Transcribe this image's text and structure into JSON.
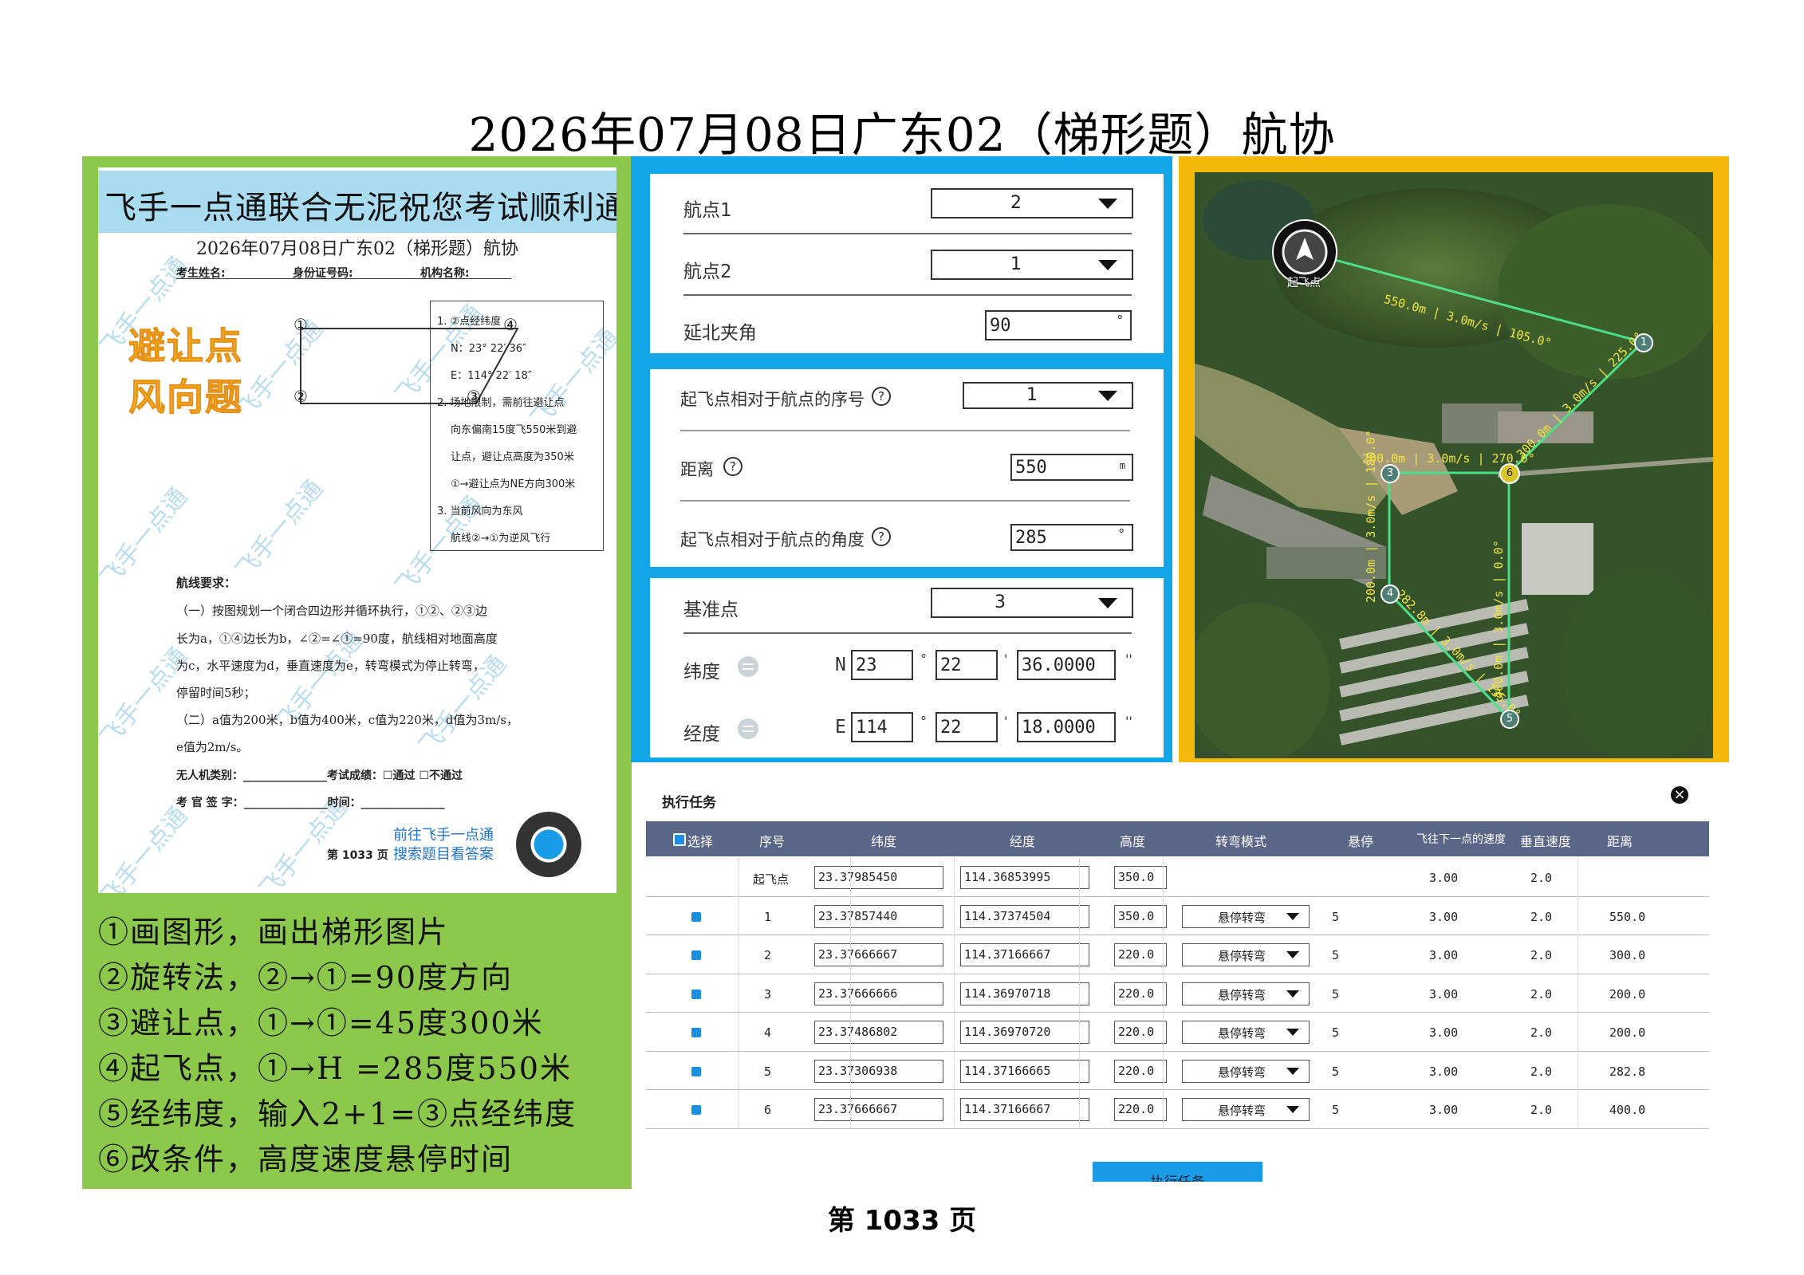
{
  "title": "2026年07月08日广东02（梯形题）航协",
  "page_number": "第 1033 页",
  "paper": {
    "banner": "飞手一点通联合无泥祝您考试顺利通过",
    "title": "2026年07月08日广东02（梯形题）航协",
    "header_fields": [
      "考生姓名:",
      "身份证号码:",
      "机构名称:"
    ],
    "sticker_line1": "避让点",
    "sticker_line2": "风向题",
    "watermark": "飞手一点通",
    "diagram_labels": [
      "①",
      "④",
      "②",
      "③"
    ],
    "box_lines": [
      "1. ②点经纬度",
      "N：23° 22′ 36″",
      "E：114° 22′ 18″",
      "2. 场地限制，需前往避让点",
      "向东偏南15度飞550米到避",
      "让点，避让点高度为350米",
      "①→避让点为NE方向300米",
      "3. 当前风向为东风",
      "航线②→①为逆风飞行"
    ],
    "req_title": "航线要求：",
    "req_lines": [
      "（一）按图规划一个闭合四边形并循环执行，①②、②③边",
      "长为a，①④边长为b，∠②=∠①=90度，航线相对地面高度",
      "为c，水平速度为d，垂直速度为e，转弯模式为停止转弯，",
      "停留时间5秒；",
      "（二）a值为200米，b值为400米，c值为220米，d值为3m/s，",
      "e值为2m/s。"
    ],
    "footer_line1": "无人机类别：_______________考试成绩：☐通过  ☐不通过",
    "footer_line2": "考 官 签 字：_______________时间：_______________",
    "footer_page": "第 1033 页",
    "promo_line1": "前往飞手一点通",
    "promo_line2": "搜索题目看答案"
  },
  "instructions": [
    "①画图形，画出梯形图片",
    "②旋转法，②→①=90度方向",
    "③避让点，①→①=45度300米",
    "④起飞点，①→H =285度550米",
    "⑤经纬度，输入2+1=③点经纬度",
    "⑥改条件，高度速度悬停时间"
  ],
  "form1": {
    "wp1_label": "航点1",
    "wp1_value": "2",
    "wp2_label": "航点2",
    "wp2_value": "1",
    "angle_label": "延北夹角",
    "angle_value": "90",
    "angle_unit": "°"
  },
  "form2": {
    "seq_label": "起飞点相对于航点的序号",
    "seq_value": "1",
    "dist_label": "距离",
    "dist_value": "550",
    "dist_unit": "m",
    "ang_label": "起飞点相对于航点的角度",
    "ang_value": "285",
    "ang_unit": "°",
    "help_icon": "?"
  },
  "form3": {
    "ref_label": "基准点",
    "ref_value": "3",
    "lat_label": "纬度",
    "lat_hemi": "N",
    "lat_deg": "23",
    "lat_min": "22",
    "lat_sec": "36.0000",
    "lon_label": "经度",
    "lon_hemi": "E",
    "lon_deg": "114",
    "lon_min": "22",
    "lon_sec": "18.0000",
    "deg_sym": "°",
    "min_sym": "'",
    "sec_sym": "''"
  },
  "map": {
    "takeoff_label": "起飞点",
    "segment_labels": [
      "550.0m | 3.0m/s | 105.0°",
      "300.0m | 3.0m/s | 225.0°",
      "200.0m | 3.0m/s | 270.0°",
      "200.0m | 3.0m/s | 180.0°",
      "282.8m | 3.0m/s | 135.0°",
      "400.0m | 3.0m/s | 0.0°"
    ],
    "waypoint_labels": [
      "1",
      "6",
      "3",
      "4",
      "5"
    ]
  },
  "table": {
    "title": "执行任务",
    "close_icon": "×",
    "headers": [
      "选择",
      "序号",
      "纬度",
      "经度",
      "高度",
      "转弯模式",
      "悬停",
      "飞往下一点的速度",
      "垂直速度",
      "距离"
    ],
    "rows": [
      {
        "seq": "起飞点",
        "lat": "23.37985450",
        "lon": "114.36853995",
        "alt": "350.0",
        "mode": "",
        "hover": "",
        "speed": "3.00",
        "vspeed": "2.0",
        "dist": ""
      },
      {
        "seq": "1",
        "lat": "23.37857440",
        "lon": "114.37374504",
        "alt": "350.0",
        "mode": "悬停转弯",
        "hover": "5",
        "speed": "3.00",
        "vspeed": "2.0",
        "dist": "550.0"
      },
      {
        "seq": "2",
        "lat": "23.37666667",
        "lon": "114.37166667",
        "alt": "220.0",
        "mode": "悬停转弯",
        "hover": "5",
        "speed": "3.00",
        "vspeed": "2.0",
        "dist": "300.0"
      },
      {
        "seq": "3",
        "lat": "23.37666666",
        "lon": "114.36970718",
        "alt": "220.0",
        "mode": "悬停转弯",
        "hover": "5",
        "speed": "3.00",
        "vspeed": "2.0",
        "dist": "200.0"
      },
      {
        "seq": "4",
        "lat": "23.37486802",
        "lon": "114.36970720",
        "alt": "220.0",
        "mode": "悬停转弯",
        "hover": "5",
        "speed": "3.00",
        "vspeed": "2.0",
        "dist": "200.0"
      },
      {
        "seq": "5",
        "lat": "23.37306938",
        "lon": "114.37166665",
        "alt": "220.0",
        "mode": "悬停转弯",
        "hover": "5",
        "speed": "3.00",
        "vspeed": "2.0",
        "dist": "282.8"
      },
      {
        "seq": "6",
        "lat": "23.37666667",
        "lon": "114.37166667",
        "alt": "220.0",
        "mode": "悬停转弯",
        "hover": "5",
        "speed": "3.00",
        "vspeed": "2.0",
        "dist": "400.0"
      }
    ],
    "execute_button": "执行任务"
  },
  "colors": {
    "green_panel": "#8cc84b",
    "blue_panel": "#12a5e8",
    "orange_frame": "#f5b90b",
    "table_header": "#5a6688",
    "route_line": "#4dde8a"
  }
}
